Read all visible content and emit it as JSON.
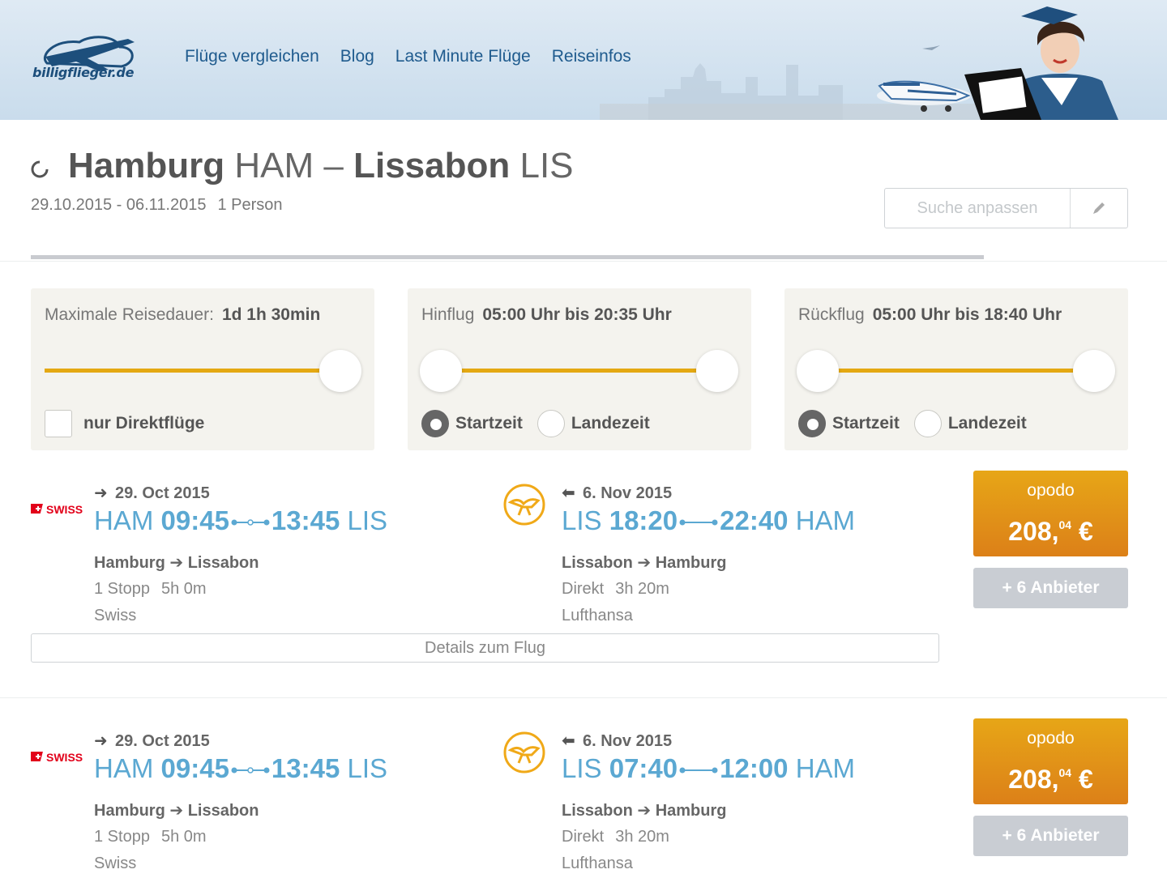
{
  "brand": {
    "logo_text": "billigflieger.de"
  },
  "nav": [
    "Flüge vergleichen",
    "Blog",
    "Last Minute Flüge",
    "Reiseinfos"
  ],
  "search": {
    "from_city": "Hamburg",
    "from_code": "HAM",
    "separator": "–",
    "to_city": "Lissabon",
    "to_code": "LIS",
    "dates": "29.10.2015 - 06.11.2015",
    "persons": "1 Person",
    "adjust_label": "Suche anpassen"
  },
  "filters": {
    "duration": {
      "label": "Maximale Reisedauer:",
      "value": "1d 1h 30min",
      "direct_label": "nur Direktflüge",
      "direct_checked": false,
      "level": 1.0
    },
    "outbound": {
      "label": "Hinflug",
      "value": "05:00 Uhr bis 20:35 Uhr",
      "radio_start": "Startzeit",
      "radio_land": "Landezeit",
      "selected": "start"
    },
    "return": {
      "label": "Rückflug",
      "value": "05:00 Uhr bis 18:40 Uhr",
      "radio_start": "Startzeit",
      "radio_land": "Landezeit",
      "selected": "start"
    }
  },
  "results": [
    {
      "outbound": {
        "airline_logo": "SWISS",
        "date": "29. Oct 2015",
        "dep_code": "HAM",
        "dep_time": "09:45",
        "arr_time": "13:45",
        "arr_code": "LIS",
        "route_from": "Hamburg",
        "route_to": "Lissabon",
        "stops": "1 Stopp",
        "duration": "5h 0m",
        "carrier": "Swiss"
      },
      "return": {
        "date": "6. Nov 2015",
        "dep_code": "LIS",
        "dep_time": "18:20",
        "arr_time": "22:40",
        "arr_code": "HAM",
        "route_from": "Lissabon",
        "route_to": "Hamburg",
        "stops": "Direkt",
        "duration": "3h 20m",
        "carrier": "Lufthansa"
      },
      "vendor": "opodo",
      "price_main": "208,",
      "price_cents": "04",
      "currency": "€",
      "more_label": "+ 6 Anbieter",
      "details_label": "Details zum Flug"
    },
    {
      "outbound": {
        "airline_logo": "SWISS",
        "date": "29. Oct 2015",
        "dep_code": "HAM",
        "dep_time": "09:45",
        "arr_time": "13:45",
        "arr_code": "LIS",
        "route_from": "Hamburg",
        "route_to": "Lissabon",
        "stops": "1 Stopp",
        "duration": "5h 0m",
        "carrier": "Swiss"
      },
      "return": {
        "date": "6. Nov 2015",
        "dep_code": "LIS",
        "dep_time": "07:40",
        "arr_time": "12:00",
        "arr_code": "HAM",
        "route_from": "Lissabon",
        "route_to": "Hamburg",
        "stops": "Direkt",
        "duration": "3h 20m",
        "carrier": "Lufthansa"
      },
      "vendor": "opodo",
      "price_main": "208,",
      "price_cents": "04",
      "currency": "€",
      "more_label": "+ 6 Anbieter"
    }
  ],
  "colors": {
    "accent_blue": "#5ba8d2",
    "slider_track": "#e4a812",
    "price_orange": "#dc8018",
    "nav_blue": "#1f5b8e"
  }
}
